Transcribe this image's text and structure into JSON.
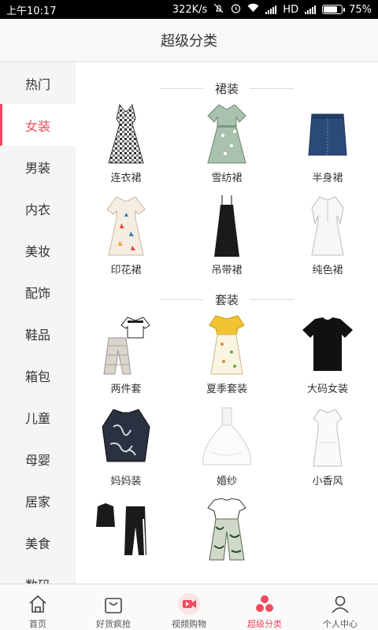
{
  "status_bar": {
    "time": "上午10:17",
    "speed": "322K/s",
    "network": "HD",
    "battery": "75%",
    "battery_level": 0.75
  },
  "header": {
    "title": "超级分类"
  },
  "sidebar": {
    "items": [
      {
        "label": "热门"
      },
      {
        "label": "女装"
      },
      {
        "label": "男装"
      },
      {
        "label": "内衣"
      },
      {
        "label": "美妆"
      },
      {
        "label": "配饰"
      },
      {
        "label": "鞋品"
      },
      {
        "label": "箱包"
      },
      {
        "label": "儿童"
      },
      {
        "label": "母婴"
      },
      {
        "label": "居家"
      },
      {
        "label": "美食"
      },
      {
        "label": "数码"
      }
    ],
    "active": "女装"
  },
  "sections": [
    {
      "title": "裙装",
      "items": [
        {
          "label": "连衣裙",
          "icon": "gingham-dress"
        },
        {
          "label": "雪纺裙",
          "icon": "chiffon-dress"
        },
        {
          "label": "半身裙",
          "icon": "denim-skirt"
        },
        {
          "label": "印花裙",
          "icon": "print-dress"
        },
        {
          "label": "吊带裙",
          "icon": "slip-dress"
        },
        {
          "label": "纯色裙",
          "icon": "solid-dress"
        }
      ]
    },
    {
      "title": "套装",
      "items": [
        {
          "label": "两件套",
          "icon": "two-piece-set"
        },
        {
          "label": "夏季套装",
          "icon": "summer-set"
        },
        {
          "label": "大码女装",
          "icon": "plus-size-tee"
        },
        {
          "label": "妈妈装",
          "icon": "mom-blouse"
        },
        {
          "label": "婚纱",
          "icon": "wedding-dress"
        },
        {
          "label": "小香风",
          "icon": "white-dress"
        },
        {
          "label": "",
          "icon": "sport-set"
        },
        {
          "label": "",
          "icon": "printed-pants-set"
        }
      ]
    }
  ],
  "tabbar": {
    "tabs": [
      {
        "label": "首页",
        "icon": "home-icon"
      },
      {
        "label": "好货疯抢",
        "icon": "bag-icon"
      },
      {
        "label": "视频购物",
        "icon": "video-icon"
      },
      {
        "label": "超级分类",
        "icon": "category-icon"
      },
      {
        "label": "个人中心",
        "icon": "user-icon"
      }
    ],
    "active": "超级分类"
  },
  "colors": {
    "accent": "#ef4b5e",
    "sidebar_bg": "#f5f5f5",
    "divider": "#dcdcdc"
  }
}
